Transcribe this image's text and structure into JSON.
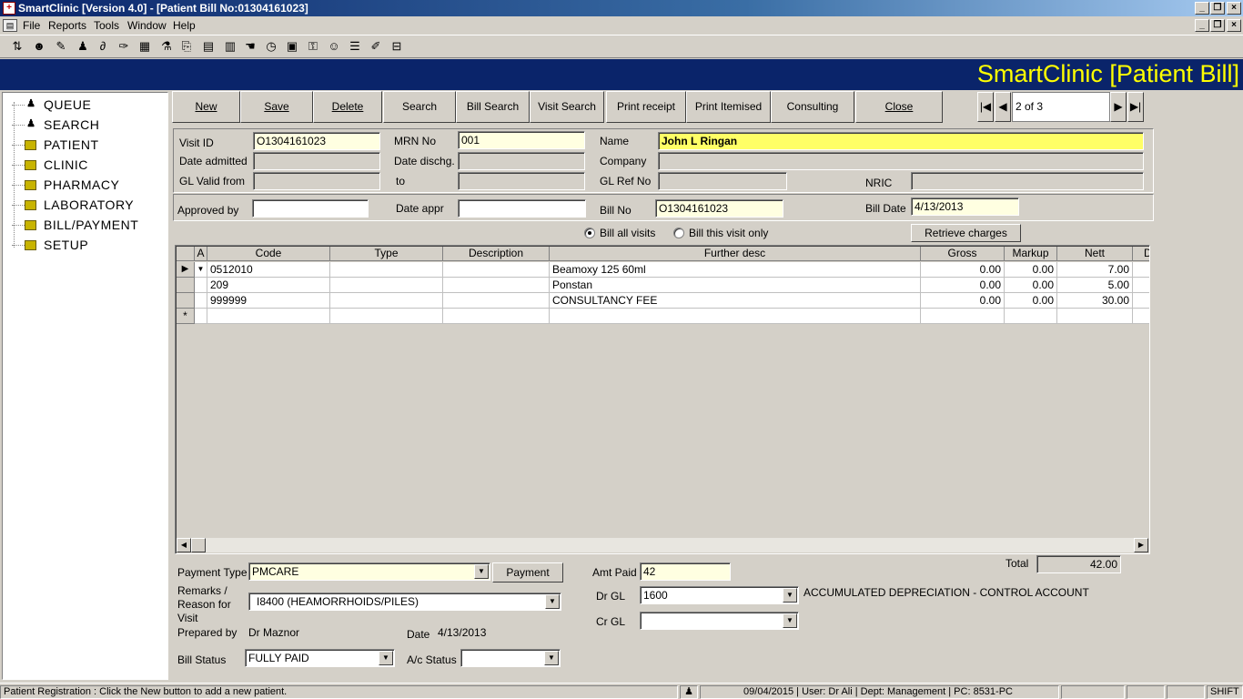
{
  "window": {
    "title": "SmartClinic [Version 4.0] - [Patient Bill No:01304161023]"
  },
  "menu": [
    "File",
    "Reports",
    "Tools",
    "Window",
    "Help"
  ],
  "banner": {
    "title": "SmartClinic [Patient Bill]"
  },
  "sidebar": {
    "items": [
      {
        "label": "QUEUE",
        "icon": "person-icon"
      },
      {
        "label": "SEARCH",
        "icon": "person-icon"
      },
      {
        "label": "PATIENT",
        "icon": "folder-icon"
      },
      {
        "label": "CLINIC",
        "icon": "folder-icon"
      },
      {
        "label": "PHARMACY",
        "icon": "folder-icon"
      },
      {
        "label": "LABORATORY",
        "icon": "folder-icon"
      },
      {
        "label": "BILL/PAYMENT",
        "icon": "folder-icon"
      },
      {
        "label": "SETUP",
        "icon": "folder-icon"
      }
    ]
  },
  "actions": {
    "new": "New",
    "save": "Save",
    "delete": "Delete",
    "search": "Search",
    "bill_search": "Bill Search",
    "visit_search": "Visit Search",
    "print_receipt": "Print receipt",
    "print_itemised": "Print Itemised",
    "consulting": "Consulting",
    "close": "Close"
  },
  "navigator": {
    "position": "2 of 3"
  },
  "form": {
    "visit_id_label": "Visit ID",
    "visit_id": "O1304161023",
    "mrn_label": "MRN No",
    "mrn": "001",
    "name_label": "Name",
    "name": "John L Ringan",
    "date_admitted_label": "Date admitted",
    "date_admitted": "",
    "date_dischg_label": "Date dischg.",
    "date_dischg": "",
    "company_label": "Company",
    "company": "",
    "gl_valid_from_label": "GL Valid from",
    "gl_valid_from": "",
    "to_label": "to",
    "to": "",
    "gl_ref_label": "GL Ref No",
    "gl_ref": "",
    "nric_label": "NRIC",
    "nric": "",
    "approved_by_label": "Approved by",
    "approved_by": "",
    "date_appr_label": "Date appr",
    "date_appr": "",
    "bill_no_label": "Bill No",
    "bill_no": "O1304161023",
    "bill_date_label": "Bill Date",
    "bill_date": "4/13/2013",
    "bill_all_visits": "Bill all visits",
    "bill_this_visit": "Bill this visit only",
    "retrieve_charges": "Retrieve charges"
  },
  "grid": {
    "columns": [
      "A",
      "Code",
      "Type",
      "Description",
      "Further desc",
      "Gross",
      "Markup",
      "Nett",
      "D"
    ],
    "rows": [
      {
        "code": "0512010",
        "type": "",
        "description": "",
        "further": "Beamoxy 125 60ml",
        "gross": "0.00",
        "markup": "0.00",
        "nett": "7.00"
      },
      {
        "code": "209",
        "type": "",
        "description": "",
        "further": "Ponstan",
        "gross": "0.00",
        "markup": "0.00",
        "nett": "5.00"
      },
      {
        "code": "999999",
        "type": "",
        "description": "",
        "further": "CONSULTANCY FEE",
        "gross": "0.00",
        "markup": "0.00",
        "nett": "30.00"
      }
    ]
  },
  "footer": {
    "total_label": "Total",
    "total": "42.00",
    "payment_type_label": "Payment Type",
    "payment_type": "PMCARE",
    "payment_button": "Payment",
    "amt_paid_label": "Amt Paid",
    "amt_paid": "42",
    "remarks_label_1": "Remarks /",
    "remarks_label_2": "Reason for",
    "remarks_label_3": "Visit",
    "remarks": "I8400 (HEAMORRHOIDS/PILES)",
    "dr_gl_label": "Dr GL",
    "dr_gl": "1600",
    "dr_gl_desc": "ACCUMULATED DEPRECIATION - CONTROL ACCOUNT",
    "cr_gl_label": "Cr GL",
    "cr_gl": "",
    "prepared_by_label": "Prepared by",
    "prepared_by": "Dr Maznor",
    "date_label": "Date",
    "date": "4/13/2013",
    "bill_status_label": "Bill Status",
    "bill_status": "FULLY PAID",
    "ac_status_label": "A/c Status",
    "ac_status": ""
  },
  "status": {
    "message": "Patient Registration : Click the New button to add a new patient.",
    "info": "09/04/2015 | User: Dr Ali | Dept: Management | PC: 8531-PC",
    "shift": "SHIFT"
  },
  "colors": {
    "banner_bg": "#0a246a",
    "banner_text": "#ffff00",
    "field_yellow": "#ffffe1"
  }
}
